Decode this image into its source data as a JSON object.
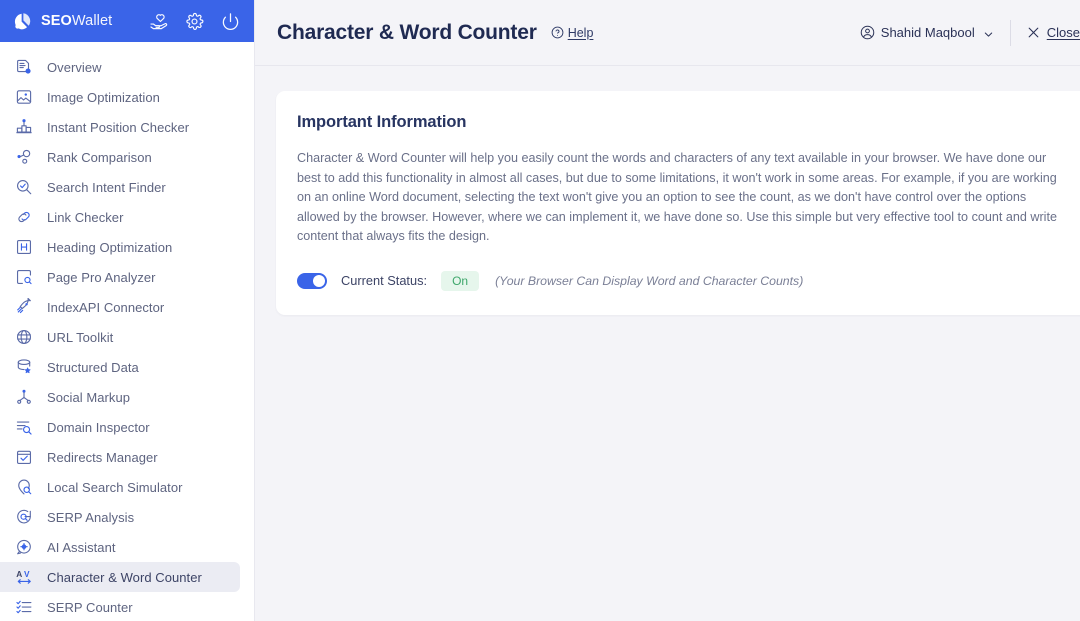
{
  "brand": {
    "logo_icon": "pie-chart-logo-icon",
    "name_bold": "SEO",
    "name_light": "Wallet",
    "actions": [
      {
        "icon": "hand-heart-icon",
        "name": "support-icon"
      },
      {
        "icon": "gear-icon",
        "name": "settings-icon"
      },
      {
        "icon": "power-icon",
        "name": "power-icon"
      }
    ]
  },
  "sidebar": {
    "items": [
      {
        "label": "Overview",
        "icon": "document-clock-icon",
        "active": false
      },
      {
        "label": "Image Optimization",
        "icon": "image-icon",
        "active": false
      },
      {
        "label": "Instant Position Checker",
        "icon": "podium-icon",
        "active": false
      },
      {
        "label": "Rank Comparison",
        "icon": "nodes-compare-icon",
        "active": false
      },
      {
        "label": "Search Intent Finder",
        "icon": "magnifier-check-icon",
        "active": false
      },
      {
        "label": "Link Checker",
        "icon": "link-icon",
        "active": false
      },
      {
        "label": "Heading Optimization",
        "icon": "heading-h-icon",
        "active": false
      },
      {
        "label": "Page Pro Analyzer",
        "icon": "page-search-icon",
        "active": false
      },
      {
        "label": "IndexAPI Connector",
        "icon": "rocket-icon",
        "active": false
      },
      {
        "label": "URL Toolkit",
        "icon": "globe-icon",
        "active": false
      },
      {
        "label": "Structured Data",
        "icon": "database-star-icon",
        "active": false
      },
      {
        "label": "Social Markup",
        "icon": "share-nodes-icon",
        "active": false
      },
      {
        "label": "Domain Inspector",
        "icon": "list-search-icon",
        "active": false
      },
      {
        "label": "Redirects Manager",
        "icon": "checkbox-square-icon",
        "active": false
      },
      {
        "label": "Local Search Simulator",
        "icon": "map-pin-search-icon",
        "active": false
      },
      {
        "label": "SERP Analysis",
        "icon": "speech-magnifier-icon",
        "active": false
      },
      {
        "label": "AI Assistant",
        "icon": "chat-gear-icon",
        "active": false
      },
      {
        "label": "Character & Word Counter",
        "icon": "av-arrows-icon",
        "active": true
      },
      {
        "label": "SERP Counter",
        "icon": "checklist-icon",
        "active": false
      }
    ]
  },
  "header": {
    "title": "Character & Word Counter",
    "help_label": "Help",
    "help_icon": "question-circle-icon",
    "user_name": "Shahid Maqbool",
    "user_icon": "account-circle-icon",
    "caret_icon": "chevron-down-icon",
    "close_label": "Close",
    "close_icon": "close-x-icon"
  },
  "card": {
    "title": "Important Information",
    "body": "Character & Word Counter will help you easily count the words and characters of any text available in your browser. We have done our best to add this functionality in almost all cases, but due to some limitations, it won't work in some areas. For example, if you are working on an online Word document, selecting the text won't give you an option to see the count, as we don't have control over the options allowed by the browser. However, where we can implement it, we have done so. Use this simple but very effective tool to count and write content that always fits the design.",
    "status_label": "Current Status:",
    "status_badge": "On",
    "status_note": "(Your Browser Can Display Word and Character Counts)",
    "toggle_state": "on"
  },
  "colors": {
    "brand_blue": "#3a64e8",
    "page_bg": "#f4f4f8",
    "card_bg": "#ffffff",
    "title_navy": "#1f2a52",
    "badge_green_text": "#3ea76b",
    "badge_green_bg": "#e6f6ec",
    "active_item_bg": "#ebecf3"
  }
}
